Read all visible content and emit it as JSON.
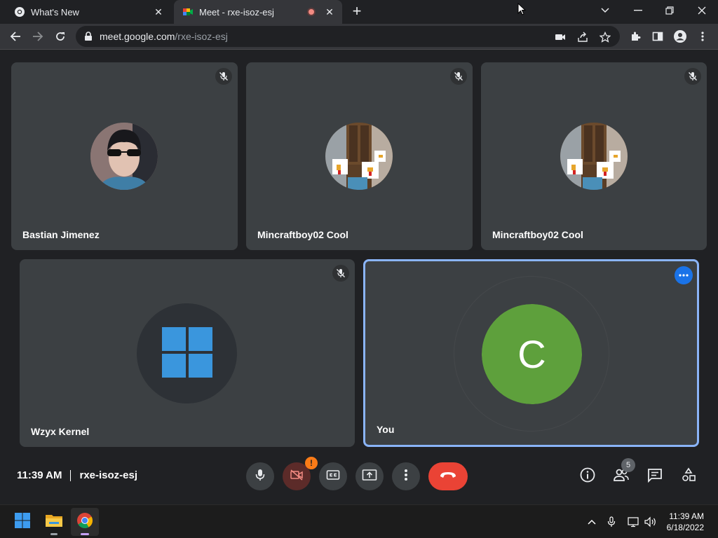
{
  "browser": {
    "tabs": [
      {
        "title": "What's New",
        "icon": "chrome-icon"
      },
      {
        "title": "Meet - rxe-isoz-esj",
        "icon": "meet-icon",
        "recording": true
      }
    ],
    "url_host": "meet.google.com",
    "url_path": "/rxe-isoz-esj"
  },
  "participants": [
    {
      "name": "Bastian Jimenez",
      "muted": true
    },
    {
      "name": "Mincraftboy02 Cool",
      "muted": true
    },
    {
      "name": "Mincraftboy02 Cool",
      "muted": true
    },
    {
      "name": "Wzyx Kernel",
      "muted": true
    },
    {
      "name": "You",
      "initial": "C",
      "avatar_color": "#5ea03c"
    }
  ],
  "meeting": {
    "time": "11:39 AM",
    "code": "rxe-isoz-esj",
    "camera_warning": "!",
    "people_count": "5"
  },
  "taskbar": {
    "time": "11:39 AM",
    "date": "6/18/2022"
  },
  "colors": {
    "end_call": "#ea4335",
    "accent": "#8ab4f8",
    "warning": "#fa7b17"
  }
}
